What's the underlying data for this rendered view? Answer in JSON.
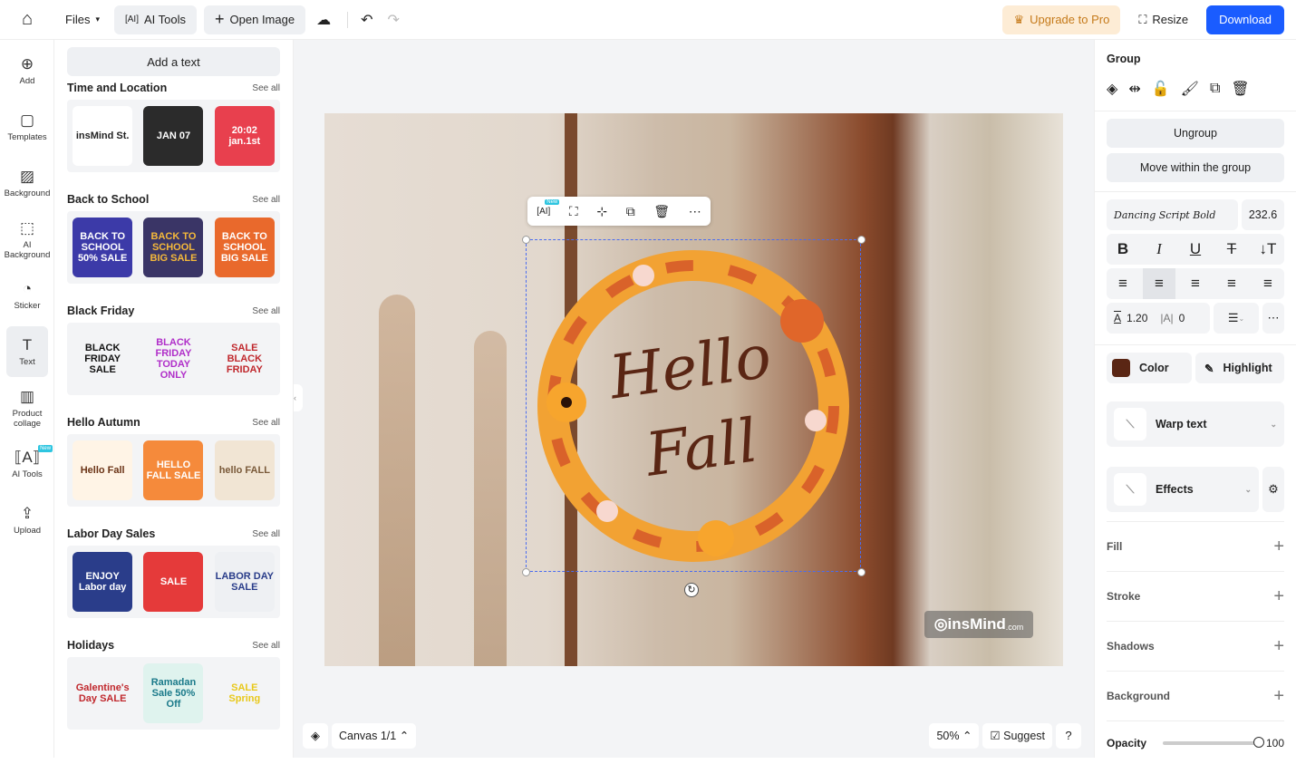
{
  "topbar": {
    "files": "Files",
    "ai_tools": "AI Tools",
    "open_image": "Open Image",
    "upgrade": "Upgrade to Pro",
    "resize": "Resize",
    "download": "Download"
  },
  "rail": [
    {
      "label": "Add",
      "icon": "⊕"
    },
    {
      "label": "Templates",
      "icon": "▢"
    },
    {
      "label": "Background",
      "icon": "▨"
    },
    {
      "label": "AI Background",
      "icon": "⬚"
    },
    {
      "label": "Sticker",
      "icon": "◔"
    },
    {
      "label": "Text",
      "icon": "T"
    },
    {
      "label": "Product collage",
      "icon": "▥"
    },
    {
      "label": "AI Tools",
      "icon": "⟦A⟧",
      "badge": "New"
    },
    {
      "label": "Upload",
      "icon": "⇪"
    }
  ],
  "panel": {
    "add_text": "Add a text",
    "see_all": "See all",
    "sections": [
      {
        "title": "Time and Location",
        "items": [
          {
            "text": "insMind St.",
            "bg": "#ffffff",
            "fg": "#222"
          },
          {
            "text": "JAN 07",
            "bg": "#2b2b2b",
            "fg": "#fff"
          },
          {
            "text": "20:02 jan.1st",
            "bg": "#e8404e",
            "fg": "#fff"
          }
        ]
      },
      {
        "title": "Back to School",
        "items": [
          {
            "text": "BACK TO SCHOOL 50% SALE",
            "bg": "#3c3aa8",
            "fg": "#fff"
          },
          {
            "text": "BACK TO SCHOOL BIG SALE",
            "bg": "#3a3566",
            "fg": "#f5b93a"
          },
          {
            "text": "BACK TO SCHOOL BIG SALE",
            "bg": "#e9692c",
            "fg": "#fff"
          }
        ]
      },
      {
        "title": "Black Friday",
        "items": [
          {
            "text": "BLACK FRIDAY SALE",
            "bg": "#f3f4f6",
            "fg": "#111"
          },
          {
            "text": "BLACK FRIDAY TODAY ONLY",
            "bg": "#f3f4f6",
            "fg": "#b02fc9"
          },
          {
            "text": "SALE BLACK FRIDAY",
            "bg": "#f3f4f6",
            "fg": "#c0282d"
          }
        ]
      },
      {
        "title": "Hello Autumn",
        "items": [
          {
            "text": "Hello Fall",
            "bg": "#fff4e6",
            "fg": "#6b3417"
          },
          {
            "text": "HELLO FALL SALE",
            "bg": "#f58a3b",
            "fg": "#fff"
          },
          {
            "text": "hello FALL",
            "bg": "#f1e5d4",
            "fg": "#7a5a3a"
          }
        ]
      },
      {
        "title": "Labor Day Sales",
        "items": [
          {
            "text": "ENJOY Labor day",
            "bg": "#2a3d8a",
            "fg": "#fff"
          },
          {
            "text": "SALE",
            "bg": "#e53a3a",
            "fg": "#fff"
          },
          {
            "text": "LABOR DAY SALE",
            "bg": "#eef0f3",
            "fg": "#2a3d8a"
          }
        ]
      },
      {
        "title": "Holidays",
        "items": [
          {
            "text": "Galentine's Day SALE",
            "bg": "#f3f4f6",
            "fg": "#c0282d"
          },
          {
            "text": "Ramadan Sale 50% Off",
            "bg": "#dff3ee",
            "fg": "#1b7a8a"
          },
          {
            "text": "SALE Spring",
            "bg": "#f3f4f6",
            "fg": "#e8c81a"
          }
        ]
      }
    ]
  },
  "canvas": {
    "headline": "Hello Fall",
    "watermark": "insMind",
    "watermark_suffix": ".com",
    "badge_new": "New",
    "page_label": "Canvas 1/1",
    "zoom": "50%",
    "suggest": "Suggest",
    "help": "?"
  },
  "right": {
    "title": "Group",
    "ungroup": "Ungroup",
    "move_within": "Move within the group",
    "font": "Dancing Script Bold",
    "font_size": "232.6",
    "line_height": "1.20",
    "letter_spacing": "0",
    "color_label": "Color",
    "color": "#5a2614",
    "highlight": "Highlight",
    "warp": "Warp text",
    "effects": "Effects",
    "fill": "Fill",
    "stroke": "Stroke",
    "shadows": "Shadows",
    "background": "Background",
    "opacity_label": "Opacity",
    "opacity": "100"
  },
  "colors": {
    "accent": "#1a5cff",
    "upgrade_bg": "#fdecd5",
    "upgrade_fg": "#c57a1a"
  }
}
